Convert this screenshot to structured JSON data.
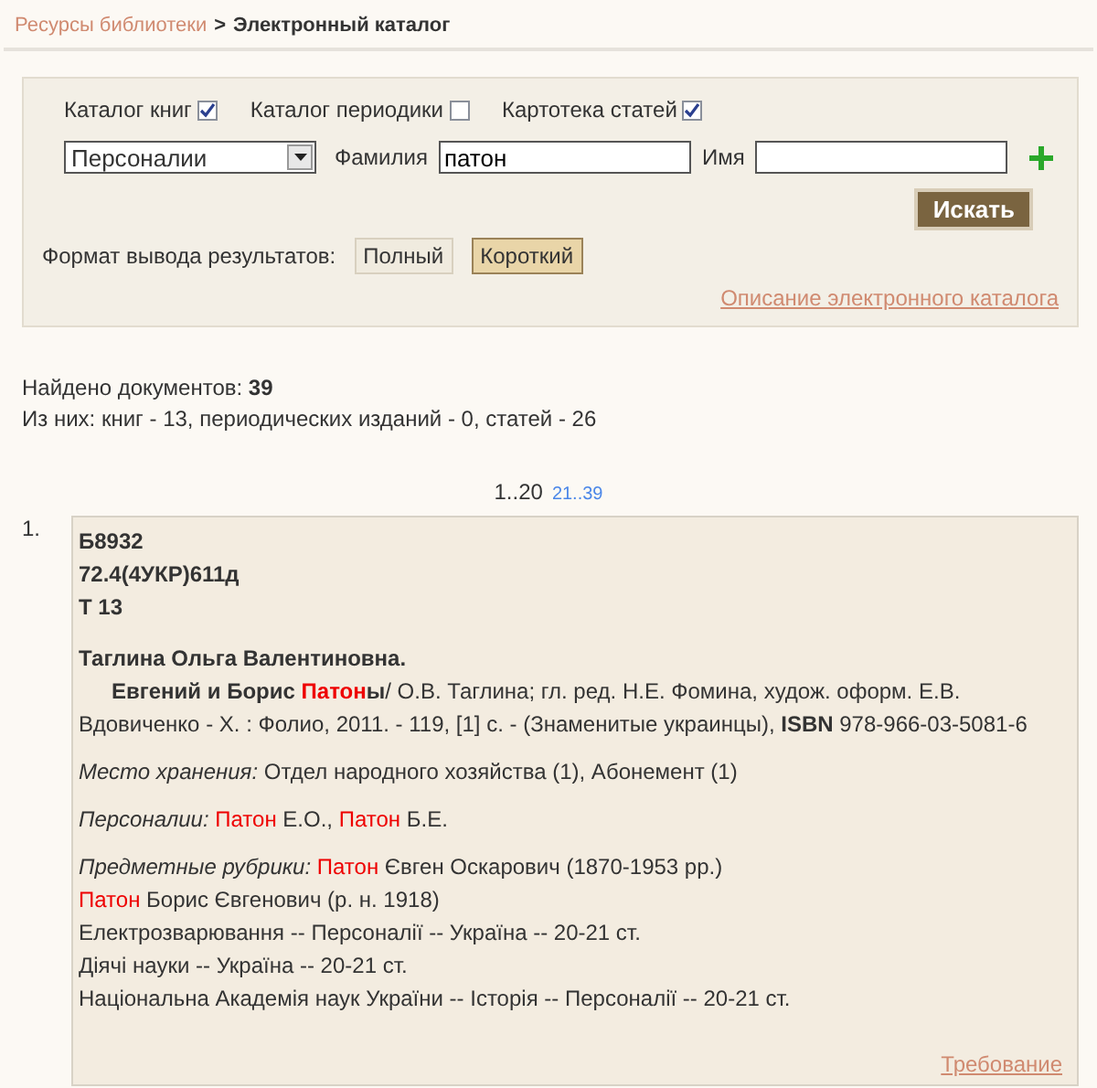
{
  "breadcrumb": {
    "link": "Ресурсы библиотеки",
    "separator": ">",
    "current": "Электронный каталог"
  },
  "search": {
    "catalogs": [
      {
        "label": "Каталог книг",
        "checked": true
      },
      {
        "label": "Каталог периодики",
        "checked": false
      },
      {
        "label": "Картотека статей",
        "checked": true
      }
    ],
    "type_select": "Персоналии",
    "surname": {
      "label": "Фамилия",
      "value": "патон"
    },
    "name": {
      "label": "Имя"
    },
    "search_button": "Искать",
    "format_label": "Формат вывода результатов:",
    "formats": [
      {
        "label": "Полный",
        "selected": false
      },
      {
        "label": "Короткий",
        "selected": true
      }
    ],
    "description_link": "Описание электронного каталога"
  },
  "summary": {
    "found_label": "Найдено документов:",
    "found_count": "39",
    "breakdown": "Из них: книг - 13, периодических изданий - 0, статей - 26"
  },
  "pages": [
    {
      "label": "1..20",
      "selected": true
    },
    {
      "label": "21..39",
      "selected": false
    }
  ],
  "records": [
    {
      "number": "1.",
      "codes": [
        "Б8932",
        "72.4(4УКР)611д",
        "Т 13"
      ],
      "author": "Таглина Ольга Валентиновна.",
      "description": [
        {
          "kind": "bold",
          "text": "Евгений и Борис "
        },
        {
          "kind": "hit-bold",
          "text": "Патон"
        },
        {
          "kind": "bold",
          "text": "ы"
        },
        {
          "kind": "plain",
          "text": "/ О.В. Таглина; гл. ред. Н.Е. Фомина, худож. оформ. Е.В. Вдовиченко - Х. : Фолио, 2011. - 119, [1] с. - (Знаменитые украинцы), "
        },
        {
          "kind": "bold",
          "text": "ISBN"
        },
        {
          "kind": "plain",
          "text": " 978-966-03-5081-6"
        }
      ],
      "sections": [
        [
          [
            {
              "kind": "label",
              "text": "Место хранения:"
            },
            {
              "kind": "plain",
              "text": " Отдел народного хозяйства (1), Абонемент (1)"
            }
          ]
        ],
        [
          [
            {
              "kind": "label",
              "text": "Персоналии:"
            },
            {
              "kind": "hit",
              "text": " Патон"
            },
            {
              "kind": "plain",
              "text": " Е.О., "
            },
            {
              "kind": "hit",
              "text": "Патон"
            },
            {
              "kind": "plain",
              "text": " Б.Е."
            }
          ]
        ],
        [
          [
            {
              "kind": "label",
              "text": "Предметные рубрики:"
            },
            {
              "kind": "hit",
              "text": " Патон"
            },
            {
              "kind": "plain",
              "text": " Євген Оскарович (1870-1953 рр.)"
            }
          ],
          [
            {
              "kind": "hit",
              "text": "Патон"
            },
            {
              "kind": "plain",
              "text": " Борис Євгенович (р. н. 1918)"
            }
          ],
          [
            {
              "kind": "plain",
              "text": "Електрозварювання -- Персоналії -- Україна -- 20-21 ст."
            }
          ],
          [
            {
              "kind": "plain",
              "text": "Діячі науки -- Україна -- 20-21 ст."
            }
          ],
          [
            {
              "kind": "plain",
              "text": "Національна Академія наук України -- Історія -- Персоналії -- 20-21 ст."
            }
          ]
        ]
      ],
      "request_link": "Требование"
    }
  ]
}
